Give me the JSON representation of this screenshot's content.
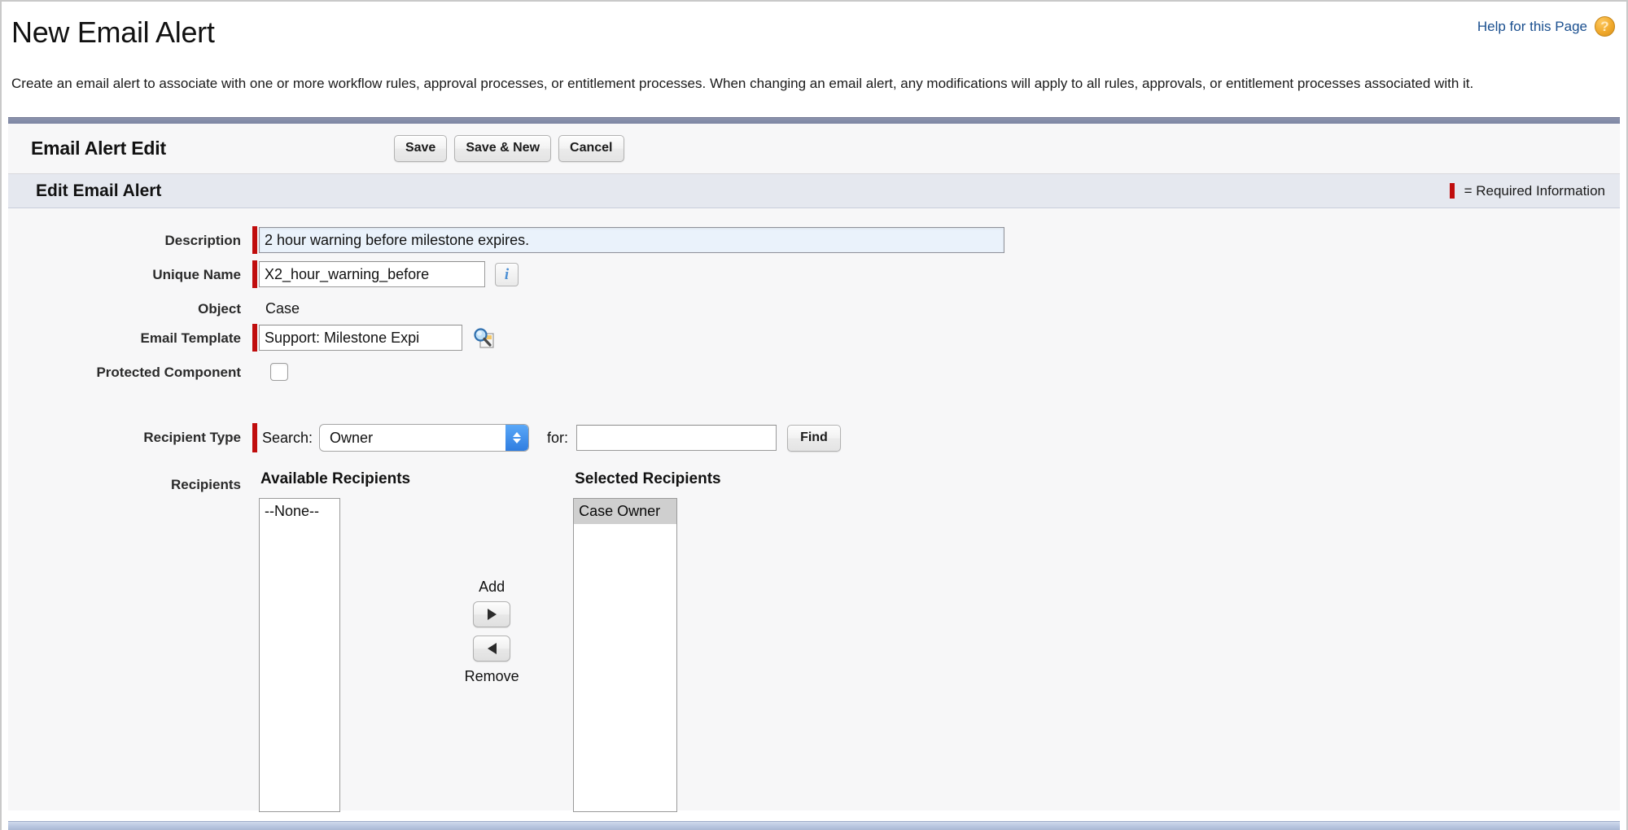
{
  "page": {
    "title": "New Email Alert",
    "description": "Create an email alert to associate with one or more workflow rules, approval processes, or entitlement processes. When changing an email alert, any modifications will apply to all rules, approvals, or entitlement processes associated with it.",
    "help_link": "Help for this Page",
    "help_icon": "help-question-icon"
  },
  "button_bar": {
    "title": "Email Alert Edit",
    "save_label": "Save",
    "save_new_label": "Save & New",
    "cancel_label": "Cancel"
  },
  "subsection": {
    "title": "Edit Email Alert",
    "required_legend": "= Required Information",
    "required_color": "#c00d0d"
  },
  "form": {
    "description": {
      "label": "Description",
      "value": "2 hour warning before milestone expires.",
      "required": true,
      "focused": true
    },
    "unique_name": {
      "label": "Unique Name",
      "value": "X2_hour_warning_before",
      "required": true,
      "info_icon": "info-icon"
    },
    "object": {
      "label": "Object",
      "value": "Case"
    },
    "email_template": {
      "label": "Email Template",
      "value": "Support: Milestone Expi",
      "required": true,
      "lookup_icon": "lookup-search-icon"
    },
    "protected_component": {
      "label": "Protected Component",
      "checked": false
    },
    "recipient_type": {
      "label": "Recipient Type",
      "required": true,
      "search_label": "Search:",
      "selected_option": "Owner",
      "options": [
        "Owner"
      ],
      "for_label": "for:",
      "for_value": "",
      "for_placeholder": "",
      "find_label": "Find"
    },
    "recipients": {
      "label": "Recipients",
      "available_heading": "Available Recipients",
      "selected_heading": "Selected Recipients",
      "available_options": [
        "--None--"
      ],
      "selected_options": [
        "Case Owner"
      ],
      "add_label": "Add",
      "remove_label": "Remove",
      "add_icon": "arrow-right-icon",
      "remove_icon": "arrow-left-icon"
    }
  }
}
